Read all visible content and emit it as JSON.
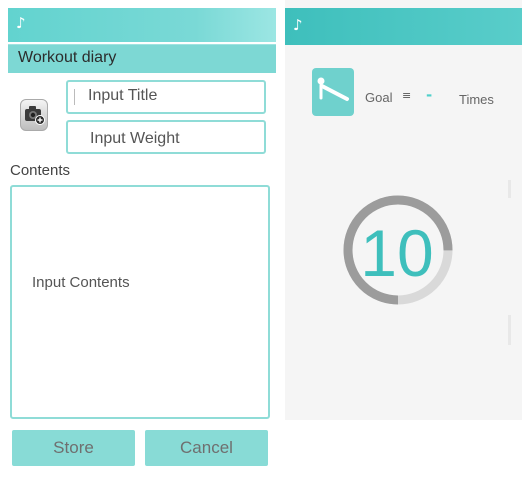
{
  "left_screen": {
    "app_icon": "♪",
    "title": "Workout diary",
    "title_input": {
      "placeholder": "Input Title",
      "leading_char": ":"
    },
    "weight_input": {
      "placeholder": "Input Weight"
    },
    "contents_label": "Contents",
    "contents_input": {
      "placeholder": "Input Contents"
    },
    "buttons": {
      "store": "Store",
      "cancel": "Cancel"
    }
  },
  "right_screen": {
    "app_icon": "♪",
    "exercise_icon": "pushup-icon",
    "goal_label": "Goal",
    "goal_separator": "≡",
    "goal_value": "-",
    "times_label": "Times",
    "counter": {
      "value": "10",
      "progress": 0.75
    }
  },
  "colors": {
    "accent": "#62d3cf",
    "accent_dark": "#3ebfbc",
    "button": "#88dbd6",
    "field_border": "#8fdcd7"
  }
}
